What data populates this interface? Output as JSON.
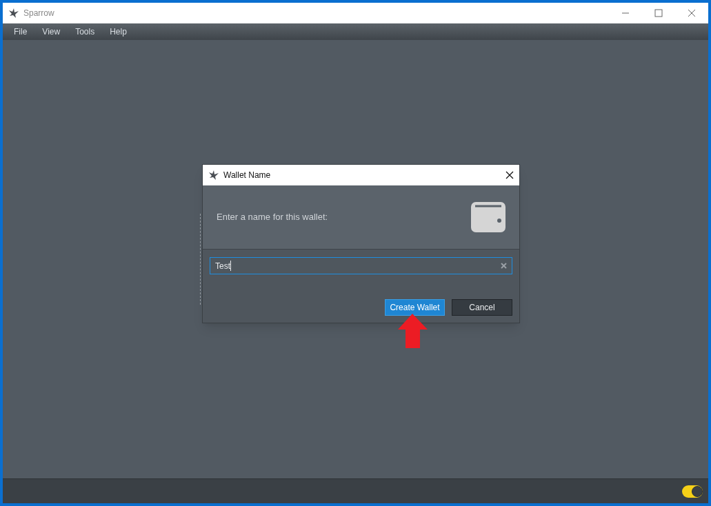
{
  "window": {
    "title": "Sparrow"
  },
  "menu": [
    "File",
    "View",
    "Tools",
    "Help"
  ],
  "dialog": {
    "title": "Wallet Name",
    "prompt": "Enter a name for this wallet:",
    "field": {
      "value": "Test",
      "focused": true
    },
    "buttons": [
      {
        "label": "Create Wallet",
        "kind": "primary"
      },
      {
        "label": "Cancel",
        "kind": "secondary"
      }
    ]
  },
  "status_bar": {
    "toggle": {
      "on": true
    }
  }
}
